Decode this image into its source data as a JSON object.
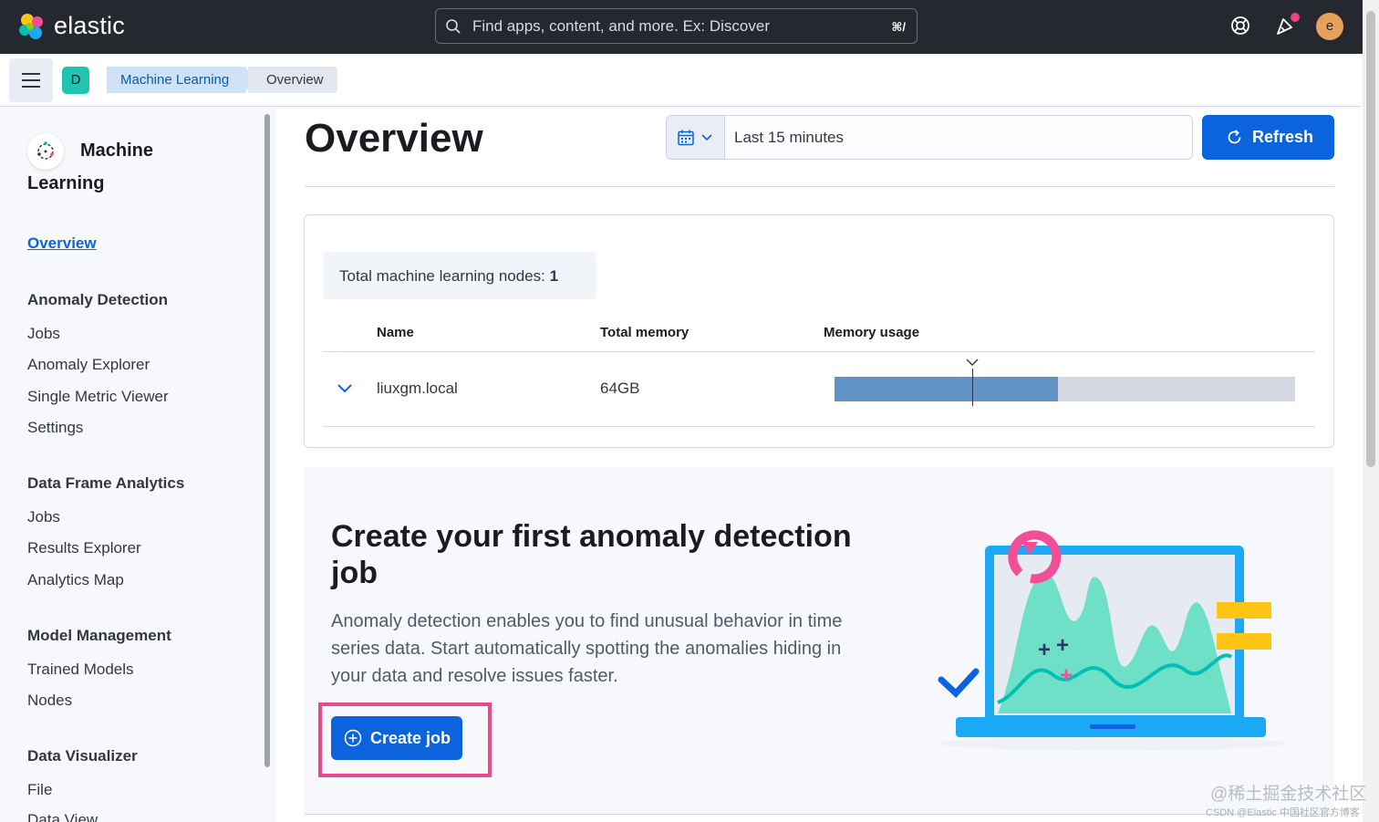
{
  "header": {
    "brand": "elastic",
    "search_placeholder": "Find apps, content, and more. Ex: Discover",
    "search_shortcut": "⌘/",
    "avatar_initial": "e"
  },
  "breadcrumb": {
    "space_initial": "D",
    "items": [
      "Machine Learning",
      "Overview"
    ]
  },
  "sidebar": {
    "title_line1": "Machine",
    "title_line2": "Learning",
    "active_item": "Overview",
    "groups": [
      {
        "label": "Anomaly Detection",
        "items": [
          "Jobs",
          "Anomaly Explorer",
          "Single Metric Viewer",
          "Settings"
        ]
      },
      {
        "label": "Data Frame Analytics",
        "items": [
          "Jobs",
          "Results Explorer",
          "Analytics Map"
        ]
      },
      {
        "label": "Model Management",
        "items": [
          "Trained Models",
          "Nodes"
        ]
      },
      {
        "label": "Data Visualizer",
        "items": [
          "File",
          "Data View"
        ]
      }
    ]
  },
  "main": {
    "title": "Overview",
    "date_range": "Last 15 minutes",
    "refresh_label": "Refresh",
    "nodes_label": "Total machine learning nodes:",
    "nodes_count": "1",
    "table": {
      "columns": [
        "Name",
        "Total memory",
        "Memory usage"
      ],
      "rows": [
        {
          "name": "liuxgm.local",
          "total_memory": "64GB",
          "memory_usage_fraction": 0.485,
          "marker_fraction": 0.3
        }
      ]
    },
    "promo": {
      "title": "Create your first anomaly detection job",
      "description": "Anomaly detection enables you to find unusual behavior in time series data. Start automatically spotting the anomalies hiding in your data and resolve issues faster.",
      "button_label": "Create job"
    }
  },
  "watermark": {
    "line1": "@稀土掘金技术社区",
    "line2": "CSDN @Elastic 中国社区官方博客"
  },
  "colors": {
    "header_bg": "#25282f",
    "primary": "#0b64dd",
    "highlight": "#e8498a",
    "memory_fill": "#6092c6"
  }
}
